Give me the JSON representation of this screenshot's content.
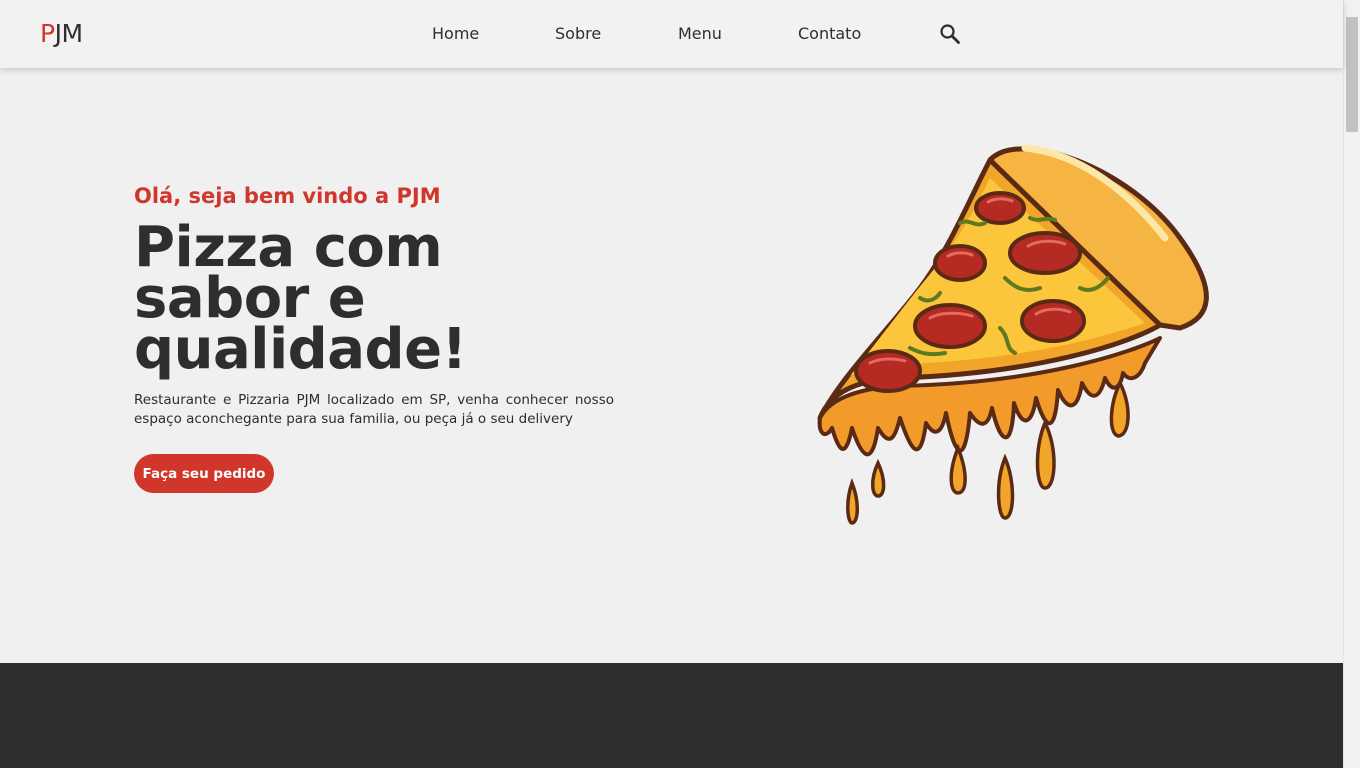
{
  "header": {
    "logo_first": "P",
    "logo_rest": "JM",
    "nav": [
      "Home",
      "Sobre",
      "Menu",
      "Contato"
    ],
    "search_icon": "search-icon"
  },
  "hero": {
    "greeting": "Olá, seja bem vindo a PJM",
    "headline": "Pizza com sabor e qualidade!",
    "description": "Restaurante e Pizzaria PJM localizado em SP, venha conhecer nosso espaço aconchegante para sua familia, ou peça já o seu delivery",
    "cta_label": "Faça seu pedido",
    "image": "pizza-slice-illustration"
  },
  "colors": {
    "accent": "#d1362a",
    "text": "#2f2d2e",
    "background": "#f0f0f0",
    "dark_section": "#2f2d2e"
  }
}
